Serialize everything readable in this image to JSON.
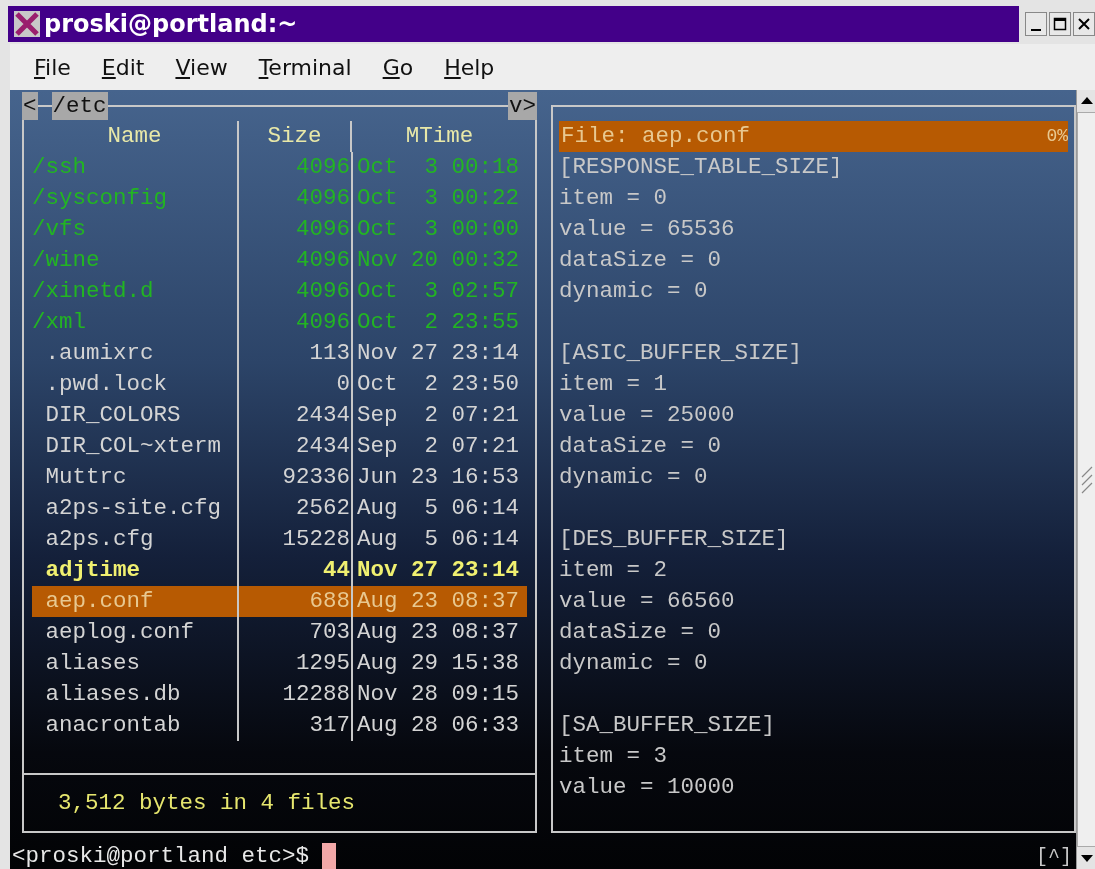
{
  "window": {
    "title": "proski@portland:~"
  },
  "menu": [
    {
      "label": "File"
    },
    {
      "label": "Edit"
    },
    {
      "label": "View"
    },
    {
      "label": "Terminal"
    },
    {
      "label": "Go"
    },
    {
      "label": "Help"
    }
  ],
  "left_panel": {
    "left_button": "<",
    "path": "/etc",
    "right_button": "v>",
    "columns": [
      "Name",
      "Size",
      "MTime"
    ],
    "rows": [
      {
        "name": "/ssh",
        "size": "4096",
        "mtime": "Oct  3 00:18",
        "kind": "directory",
        "selected": false
      },
      {
        "name": "/sysconfig",
        "size": "4096",
        "mtime": "Oct  3 00:22",
        "kind": "directory",
        "selected": false
      },
      {
        "name": "/vfs",
        "size": "4096",
        "mtime": "Oct  3 00:00",
        "kind": "directory",
        "selected": false
      },
      {
        "name": "/wine",
        "size": "4096",
        "mtime": "Nov 20 00:32",
        "kind": "directory",
        "selected": false
      },
      {
        "name": "/xinetd.d",
        "size": "4096",
        "mtime": "Oct  3 02:57",
        "kind": "directory",
        "selected": false
      },
      {
        "name": "/xml",
        "size": "4096",
        "mtime": "Oct  2 23:55",
        "kind": "directory",
        "selected": false
      },
      {
        "name": " .aumixrc",
        "size": "113",
        "mtime": "Nov 27 23:14",
        "kind": "file",
        "selected": false
      },
      {
        "name": " .pwd.lock",
        "size": "0",
        "mtime": "Oct  2 23:50",
        "kind": "file",
        "selected": false
      },
      {
        "name": " DIR_COLORS",
        "size": "2434",
        "mtime": "Sep  2 07:21",
        "kind": "file",
        "selected": false
      },
      {
        "name": " DIR_COL~xterm",
        "size": "2434",
        "mtime": "Sep  2 07:21",
        "kind": "file",
        "selected": false
      },
      {
        "name": " Muttrc",
        "size": "92336",
        "mtime": "Jun 23 16:53",
        "kind": "file",
        "selected": false
      },
      {
        "name": " a2ps-site.cfg",
        "size": "2562",
        "mtime": "Aug  5 06:14",
        "kind": "file",
        "selected": false
      },
      {
        "name": " a2ps.cfg",
        "size": "15228",
        "mtime": "Aug  5 06:14",
        "kind": "file",
        "selected": false
      },
      {
        "name": " adjtime",
        "size": "44",
        "mtime": "Nov 27 23:14",
        "kind": "executable",
        "selected": false
      },
      {
        "name": " aep.conf",
        "size": "688",
        "mtime": "Aug 23 08:37",
        "kind": "file",
        "selected": true
      },
      {
        "name": " aeplog.conf",
        "size": "703",
        "mtime": "Aug 23 08:37",
        "kind": "file",
        "selected": false
      },
      {
        "name": " aliases",
        "size": "1295",
        "mtime": "Aug 29 15:38",
        "kind": "file",
        "selected": false
      },
      {
        "name": " aliases.db",
        "size": "12288",
        "mtime": "Nov 28 09:15",
        "kind": "file",
        "selected": false
      },
      {
        "name": " anacrontab",
        "size": "317",
        "mtime": "Aug 28 06:33",
        "kind": "file",
        "selected": false
      }
    ],
    "footer": "3,512 bytes in 4 files"
  },
  "viewer": {
    "header": "File: aep.conf",
    "percent": "0%",
    "sections": [
      {
        "title": "[RESPONSE_TABLE_SIZE]",
        "lines": [
          "item = 0",
          "value = 65536",
          "dataSize = 0",
          "dynamic = 0"
        ]
      },
      {
        "title": "[ASIC_BUFFER_SIZE]",
        "lines": [
          "item = 1",
          "value = 25000",
          "dataSize = 0",
          "dynamic = 0"
        ]
      },
      {
        "title": "[DES_BUFFER_SIZE]",
        "lines": [
          "item = 2",
          "value = 66560",
          "dataSize = 0",
          "dynamic = 0"
        ]
      },
      {
        "title": "[SA_BUFFER_SIZE]",
        "lines": [
          "item = 3",
          "value = 10000"
        ]
      }
    ]
  },
  "prompt": "<proski@portland etc>$",
  "scroll_marker": "[^]"
}
